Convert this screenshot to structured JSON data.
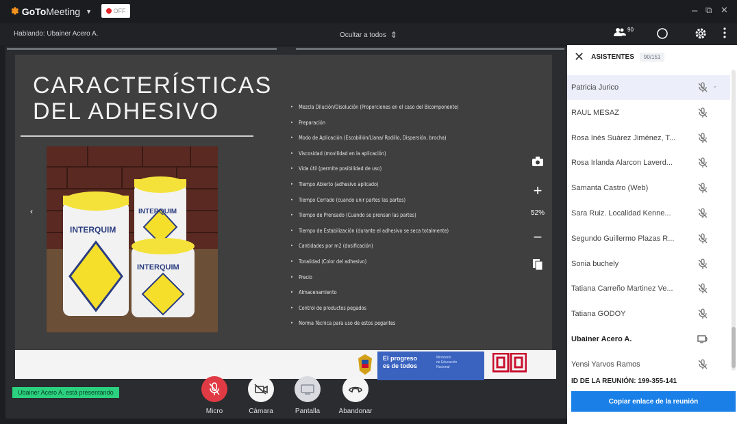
{
  "titlebar": {
    "brand_bold": "GoTo",
    "brand_light": "Meeting",
    "rec_label": "OFF",
    "minimize": "–",
    "restore": "⧉",
    "close": "✕"
  },
  "toolbar": {
    "speaking": "Hablando: Ubainer Acero A.",
    "hide_all": "Ocultar a todos",
    "attendee_count": "90"
  },
  "slide": {
    "title_line1": "CARACTERÍSTICAS",
    "title_line2": "DEL ADHESIVO",
    "bullets": [
      "Mezcla Dilución/Disolución (Proporciones en el caso del Bicomponente)",
      "Preparación",
      "Modo de Aplicación (Escobillón/Llana/ Rodillo, Dispersión, brocha)",
      "Viscosidad (movilidad en la aplicación)",
      "Vida útil (permite posibilidad de uso)",
      "Tiempo Abierto (adhesivo aplicado)",
      "Tiempo Cerrado (cuando unir partes las partes)",
      "Tiempo de Prensado (Cuando se prensan las partes)",
      "Tiempo de Estabilización (durante el adhesivo se seca totalmente)",
      "Cantidades por m2 (dosificación)",
      "Tonalidad (Color del adhesivo)",
      "Precio",
      "Almacenamiento",
      "Control de productos pegados",
      "Norma Técnica para uso de estos pegantes"
    ],
    "product_brand": "INTERQUIM",
    "gov_text_line1": "El progreso",
    "gov_text_line2": "es de todos",
    "gov_small_line1": "Ministerio",
    "gov_small_line2": "de Educación",
    "gov_small_line3": "Nacional"
  },
  "zoom": {
    "plus": "+",
    "level": "52%",
    "minus": "−",
    "left_arrow": "‹"
  },
  "presenting_text": "Ubainer Acero A. está presentando",
  "controls": {
    "mic": "Micro",
    "camera": "Cámara",
    "screen": "Pantalla",
    "leave": "Abandonar"
  },
  "colors": {
    "mic_red": "#e03b44",
    "accent_blue": "#1a80e8",
    "presenting_green": "#2bd17e"
  },
  "panel": {
    "title": "ASISTENTES",
    "count": "90/151",
    "attendees": [
      {
        "name": "Patricia Jurico",
        "bold": false,
        "selected": true
      },
      {
        "name": "RAUL MESAZ",
        "bold": false,
        "selected": false
      },
      {
        "name": "Rosa Inés Suárez Jiménez, T...",
        "bold": false,
        "selected": false
      },
      {
        "name": "Rosa Irlanda Alarcon Laverd...",
        "bold": false,
        "selected": false
      },
      {
        "name": "Samanta Castro (Web)",
        "bold": false,
        "selected": false
      },
      {
        "name": "Sara Ruiz. Localidad Kenne...",
        "bold": false,
        "selected": false
      },
      {
        "name": "Segundo Guillermo Plazas R...",
        "bold": false,
        "selected": false
      },
      {
        "name": "Sonia buchely",
        "bold": false,
        "selected": false
      },
      {
        "name": "Tatiana Carreño Martinez Ve...",
        "bold": false,
        "selected": false
      },
      {
        "name": "Tatiana GODOY",
        "bold": false,
        "selected": false
      },
      {
        "name": "Ubainer Acero A.",
        "bold": true,
        "selected": false
      },
      {
        "name": "Yensi Yarvos Ramos",
        "bold": false,
        "selected": false
      }
    ],
    "meeting_id": "ID DE LA REUNIÓN: 199-355-141",
    "copy_link": "Copiar enlace de la reunión"
  }
}
